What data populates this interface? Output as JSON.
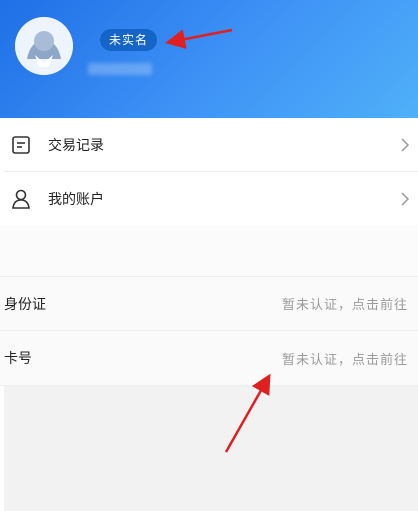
{
  "profile": {
    "badge": "未实名",
    "accent": "#1f6fe6",
    "badge_color": "#1565c9"
  },
  "menu": {
    "items": [
      {
        "label": "交易记录",
        "icon": "document-list-icon"
      },
      {
        "label": "我的账户",
        "icon": "user-outline-icon"
      }
    ]
  },
  "verify": {
    "rows": [
      {
        "label": "身份证",
        "value": "暂未认证，点击前往"
      },
      {
        "label": "卡号",
        "value": "暂未认证，点击前往"
      }
    ]
  },
  "annotations": {
    "arrow_color": "#e02020"
  }
}
